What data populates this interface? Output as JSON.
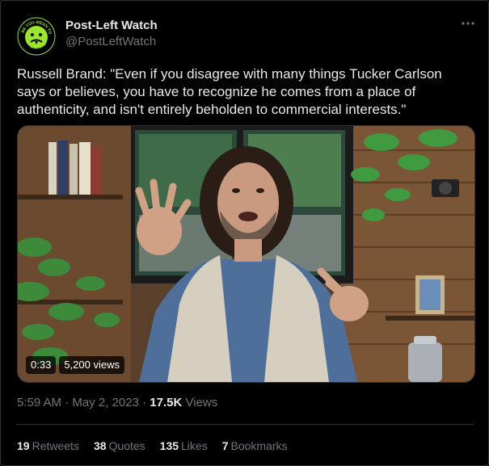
{
  "author": {
    "name": "Post-Left Watch",
    "handle": "@PostLeftWatch",
    "avatar_text_top": "BE YOU MEAN TO",
    "avatar_text_bottom": "STAY MAD"
  },
  "tweet": {
    "text": "Russell Brand: \"Even if you disagree with many things Tucker Carlson says or believes, you have to recognize he comes from a place of authenticity, and isn't entirely beholden to commercial interests.\""
  },
  "media": {
    "type": "video",
    "duration": "0:33",
    "views_label": "5,200 views"
  },
  "meta": {
    "time": "5:59 AM",
    "separator": "·",
    "date": "May 2, 2023",
    "views_count": "17.5K",
    "views_word": "Views"
  },
  "stats": {
    "retweets_count": "19",
    "retweets_label": "Retweets",
    "quotes_count": "38",
    "quotes_label": "Quotes",
    "likes_count": "135",
    "likes_label": "Likes",
    "bookmarks_count": "7",
    "bookmarks_label": "Bookmarks"
  },
  "icons": {
    "more": "more-horizontal-icon"
  },
  "colors": {
    "background": "#000000",
    "text": "#e7e9ea",
    "muted": "#71767b",
    "border": "#2f3336",
    "avatar_green": "#9be52a"
  }
}
